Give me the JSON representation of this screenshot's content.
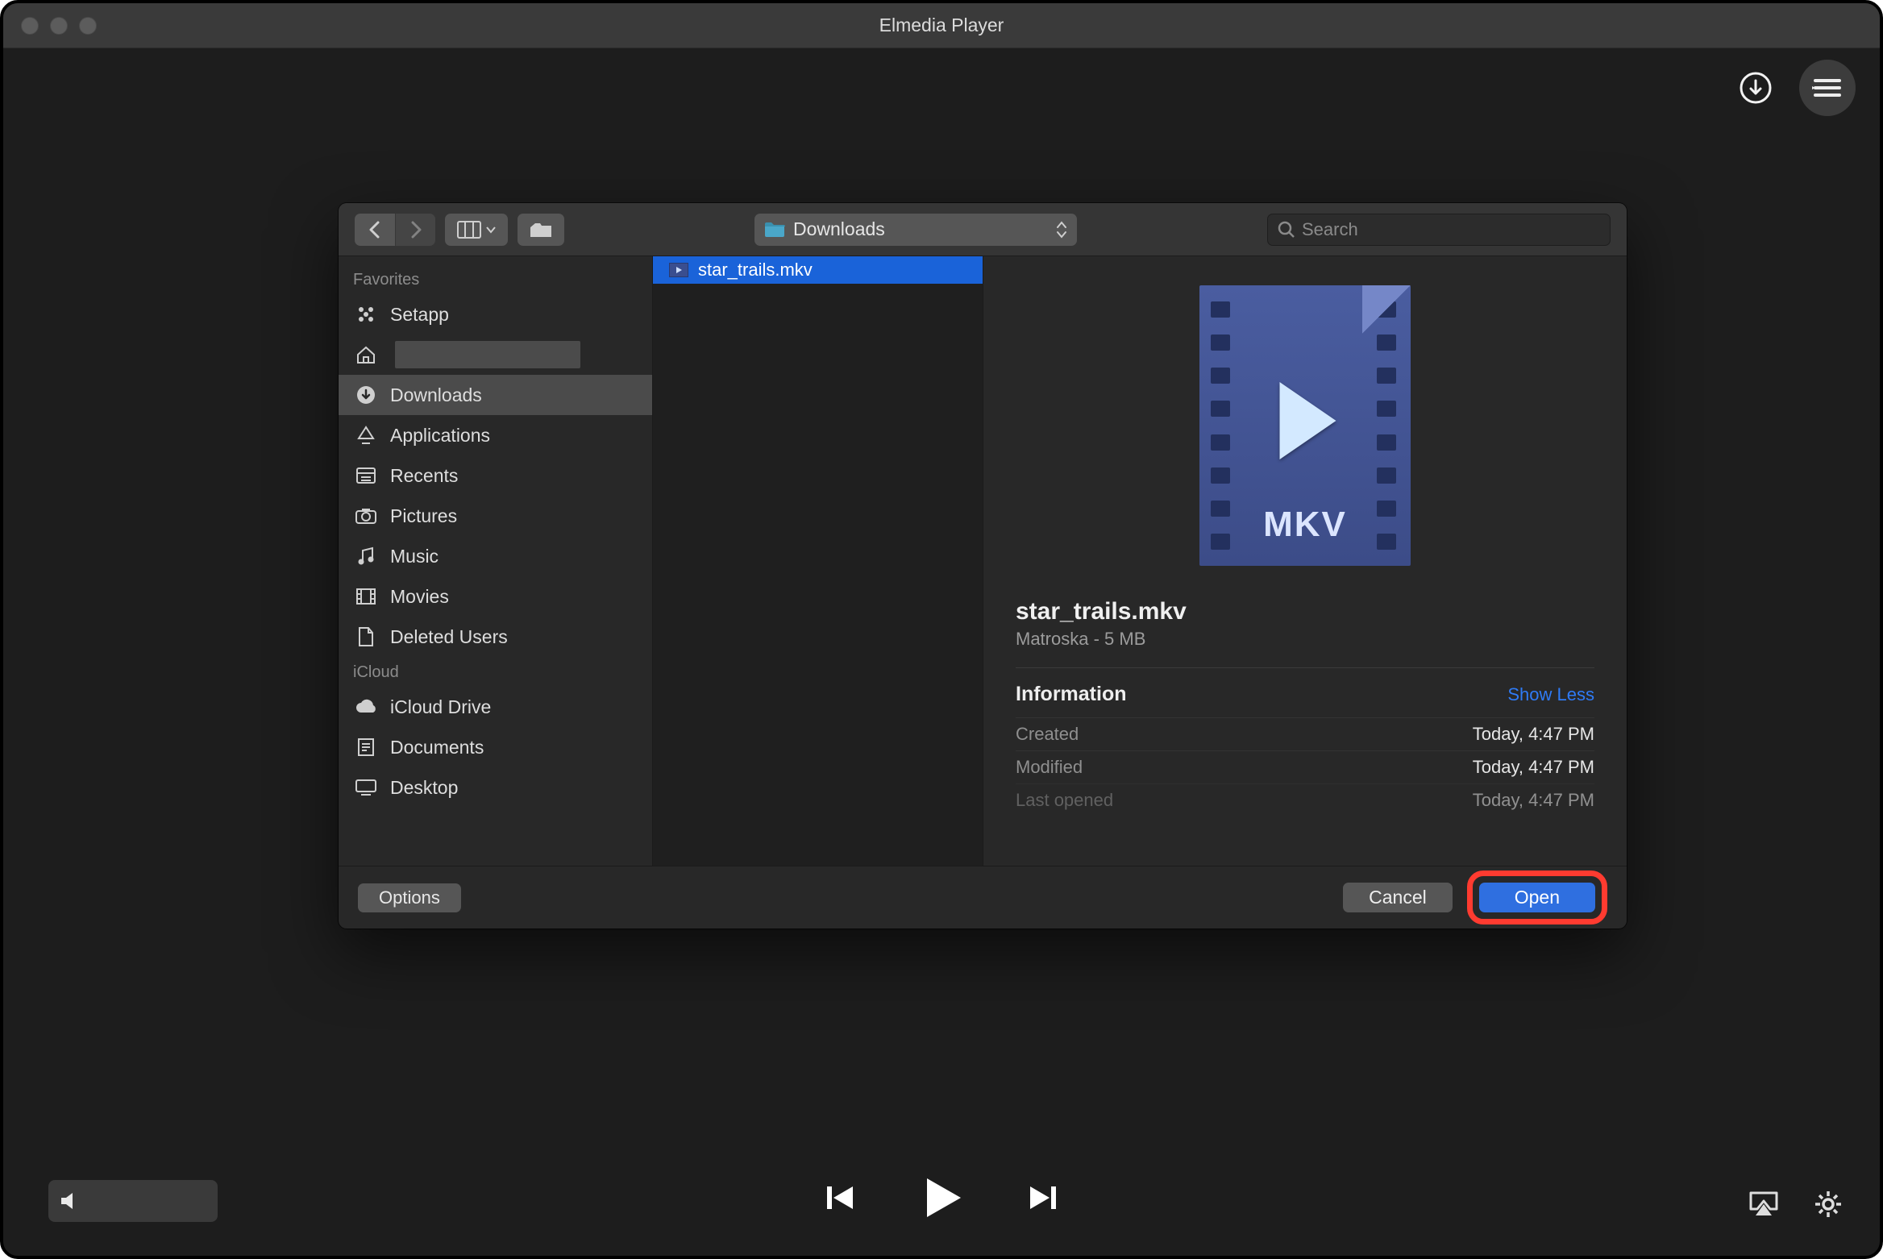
{
  "app": {
    "title": "Elmedia Player"
  },
  "dialog": {
    "location": "Downloads",
    "searchPlaceholder": "Search",
    "sidebar": {
      "sections": [
        {
          "header": "Favorites",
          "items": [
            {
              "icon": "grid",
              "label": "Setapp"
            },
            {
              "icon": "home",
              "label": ""
            },
            {
              "icon": "download",
              "label": "Downloads",
              "selected": true
            },
            {
              "icon": "apps",
              "label": "Applications"
            },
            {
              "icon": "recents",
              "label": "Recents"
            },
            {
              "icon": "camera",
              "label": "Pictures"
            },
            {
              "icon": "music",
              "label": "Music"
            },
            {
              "icon": "movie",
              "label": "Movies"
            },
            {
              "icon": "doc",
              "label": "Deleted Users"
            }
          ]
        },
        {
          "header": "iCloud",
          "items": [
            {
              "icon": "cloud",
              "label": "iCloud Drive"
            },
            {
              "icon": "docfold",
              "label": "Documents"
            },
            {
              "icon": "desktop",
              "label": "Desktop"
            }
          ]
        }
      ]
    },
    "files": [
      {
        "name": "star_trails.mkv",
        "selected": true
      }
    ],
    "preview": {
      "iconLabel": "MKV",
      "name": "star_trails.mkv",
      "subtitle": "Matroska - 5 MB",
      "infoHeader": "Information",
      "showLess": "Show Less",
      "rows": [
        {
          "k": "Created",
          "v": "Today, 4:47 PM"
        },
        {
          "k": "Modified",
          "v": "Today, 4:47 PM"
        },
        {
          "k": "Last opened",
          "v": "Today, 4:47 PM",
          "faded": true
        }
      ]
    },
    "footer": {
      "options": "Options",
      "cancel": "Cancel",
      "open": "Open"
    }
  }
}
